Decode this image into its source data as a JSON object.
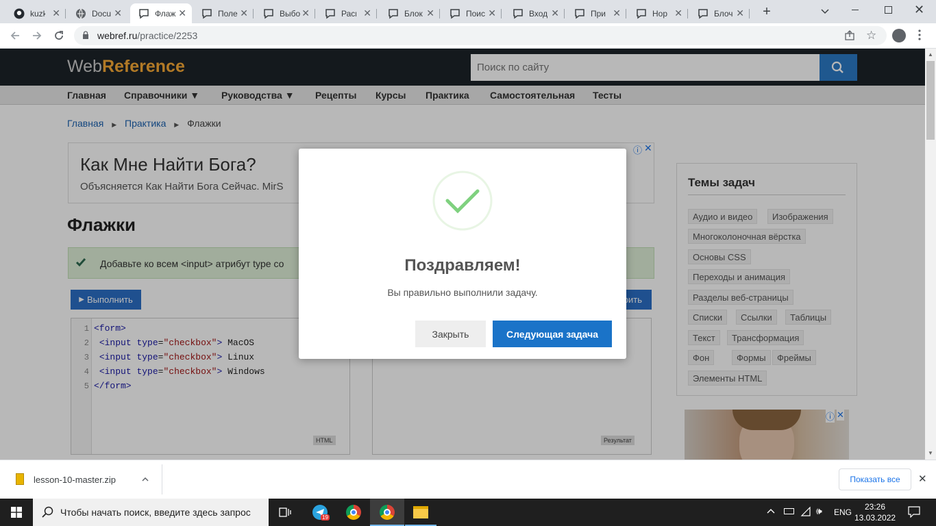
{
  "browser": {
    "tabs": [
      {
        "label": "kuzko",
        "icon": "github-icon"
      },
      {
        "label": "Docu",
        "icon": "globe-icon"
      },
      {
        "label": "Флаж",
        "icon": "speech-bubble-icon",
        "active": true
      },
      {
        "label": "Поле",
        "icon": "speech-bubble-icon"
      },
      {
        "label": "Выбо",
        "icon": "speech-bubble-icon"
      },
      {
        "label": "Раскр",
        "icon": "speech-bubble-icon"
      },
      {
        "label": "Блок",
        "icon": "speech-bubble-icon"
      },
      {
        "label": "Поис",
        "icon": "speech-bubble-icon"
      },
      {
        "label": "Вход",
        "icon": "speech-bubble-icon"
      },
      {
        "label": "При",
        "icon": "speech-bubble-icon"
      },
      {
        "label": "Нор",
        "icon": "speech-bubble-icon"
      },
      {
        "label": "Блоч",
        "icon": "speech-bubble-icon"
      }
    ],
    "url_domain": "webref.ru",
    "url_path": "/practice/2253"
  },
  "site": {
    "logo_web": "Web",
    "logo_ref": "Reference",
    "search_placeholder": "Поиск по сайту",
    "nav": [
      "Главная",
      "Справочники ▼",
      "Руководства ▼",
      "Рецепты",
      "Курсы",
      "Практика",
      "Самостоятельная",
      "Тесты"
    ],
    "breadcrumb": [
      "Главная",
      "Практика",
      "Флажки"
    ],
    "ad_title": "Как Мне Найти Бога?",
    "ad_text": "Объясняется Как Найти Бога Сейчас. MirS",
    "page_title": "Флажки",
    "task_text": "Добавьте ко всем <input> атрибут type со",
    "run_button": "Выполнить",
    "right_button_fragment": "рить",
    "code_lines": [
      "1",
      "2",
      "3",
      "4",
      "5"
    ],
    "editor_label": "HTML",
    "result_label": "Результат",
    "topics_title": "Темы задач",
    "topics": [
      [
        "Аудио и видео",
        "Изображения"
      ],
      [
        "Многоколоночная вёрстка"
      ],
      [
        "Основы CSS"
      ],
      [
        "Переходы и анимация"
      ],
      [
        "Разделы веб-страницы"
      ],
      [
        "Списки",
        "Ссылки",
        "Таблицы"
      ],
      [
        "Текст",
        "Трансформация"
      ],
      [
        "Фон",
        "Формы",
        "Фреймы"
      ],
      [
        "Элементы HTML"
      ]
    ]
  },
  "modal": {
    "title": "Поздравляем!",
    "message": "Вы правильно выполнили задачу.",
    "close_button": "Закрыть",
    "next_button": "Следующая задача",
    "accent": "#1a73c8",
    "check_color": "#7fd17f"
  },
  "download": {
    "file_name": "lesson-10-master.zip",
    "show_all": "Показать все"
  },
  "taskbar": {
    "search_text": "Чтобы начать поиск, введите здесь запрос",
    "telegram_badge": "19",
    "lang": "ENG",
    "time": "23:26",
    "date": "13.03.2022"
  }
}
